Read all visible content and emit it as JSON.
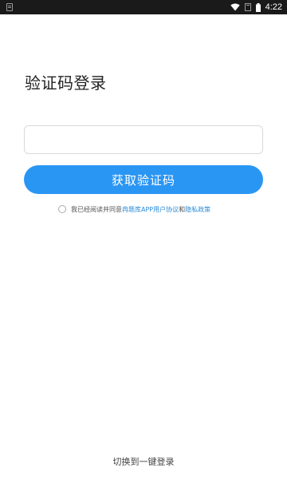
{
  "status_bar": {
    "time": "4:22",
    "icons": [
      "notification-icon",
      "wifi-icon",
      "signal-icon",
      "battery-icon"
    ]
  },
  "login": {
    "title": "验证码登录",
    "phone_input": {
      "value": "",
      "placeholder": ""
    },
    "get_code_label": "获取验证码",
    "agreement": {
      "prefix": "我已经阅读并同意",
      "user_agreement": "冉题库APP用户协议",
      "and": "和",
      "privacy_policy": "隐私政策"
    },
    "switch_login": "切换到一键登录"
  },
  "colors": {
    "primary": "#2a96f4",
    "link": "#2a8bd8",
    "status_bar": "#1a1a1a"
  }
}
